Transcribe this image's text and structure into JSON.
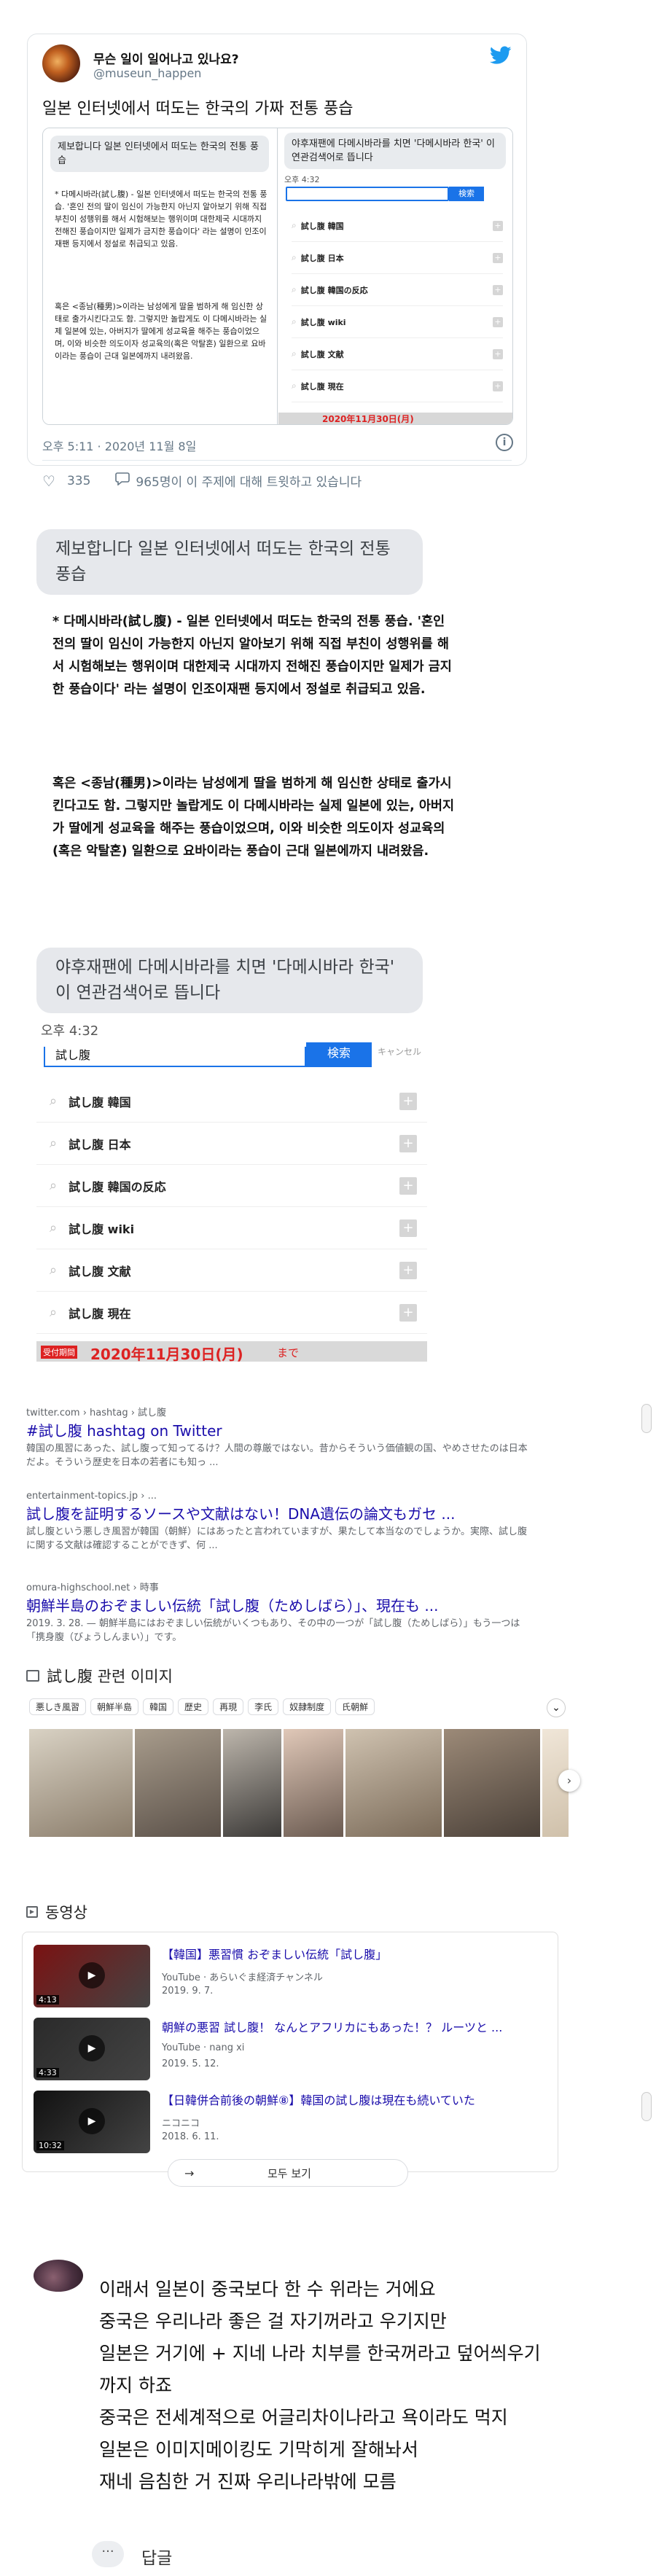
{
  "tweet": {
    "display_name": "무슨 일이 일어나고 있나요?",
    "handle": "@museun_happen",
    "text": "일본 인터넷에서 떠도는 한국의 가짜 전통 풍습",
    "media_left_bubble": "제보합니다 일본 인터넷에서 떠도는 한국의 전통 풍습",
    "media_left_p1": "* 다메시바라(試し腹) - 일본 인터넷에서 떠도는 한국의 전통 풍습. '혼인 전의 딸이 임신이 가능한지 아닌지 알아보기 위해 직접 부친이 성행위를 해서 시험해보는 행위이며 대한제국 시대까지 전해진 풍습이지만 일제가 금지한 풍습이다' 라는 설명이 인조이재팬 등지에서 정설로 취급되고 있음.",
    "media_left_p2": "혹은 <종남(種男)>이라는 남성에게 딸을 범하게 해 임신한 상태로 출가시킨다고도 함. 그렇지만 놀랍게도 이 다메시바라는 실제 일본에 있는, 아버지가 딸에게 성교육을 해주는 풍습이었으며, 이와 비슷한 의도이자 성교육의(혹은 악탈혼) 일환으로 요바이라는 풍습이 근대 일본에까지 내려왔음.",
    "media_right_bubble": "야후재팬에 다메시바라를 치면 '다메시바라 한국' 이 연관검색어로 뜹니다",
    "media_right_time": "오후 4:32",
    "media_right_search_btn": "検索",
    "media_right_items": [
      "試し腹 韓国",
      "試し腹 日本",
      "試し腹 韓国の反応",
      "試し腹 wiki",
      "試し腹 文献",
      "試し腹 現在"
    ],
    "media_right_banner": "2020年11月30日(月)",
    "timestamp": "오후 5:11 · 2020년 11월 8일",
    "likes": "335",
    "talking": "965명이 이 주제에 대해 트윗하고 있습니다",
    "info_glyph": "i"
  },
  "post": {
    "bubble1": "제보합니다 일본 인터넷에서 떠도는 한국의 전통 풍습",
    "para1": "* 다메시바라(試し腹) - 일본 인터넷에서 떠도는 한국의 전통 풍습. '혼인 전의 딸이 임신이 가능한지 아닌지 알아보기 위해 직접 부친이 성행위를 해서 시험해보는 행위이며 대한제국 시대까지 전해진 풍습이지만 일제가 금지한 풍습이다' 라는 설명이 인조이재팬 등지에서 정설로 취급되고 있음.",
    "para2": "혹은 <종남(種男)>이라는 남성에게 딸을 범하게 해 임신한 상태로 출가시킨다고도 함. 그렇지만 놀랍게도 이 다메시바라는 실제 일본에 있는, 아버지가 딸에게 성교육을 해주는 풍습이었으며, 이와 비슷한 의도이자 성교육의(혹은 악탈혼) 일환으로 요바이라는 풍습이 근대 일본에까지 내려왔음.",
    "bubble2": "야후재팬에 다메시바라를 치면 '다메시바라 한국' 이 연관검색어로 뜹니다",
    "time": "오후 4:32",
    "search_value": "試し腹",
    "search_button": "検索",
    "search_extra": "キャンセル",
    "items": [
      "試し腹 韓国",
      "試し腹 日本",
      "試し腹 韓国の反応",
      "試し腹 wiki",
      "試し腹 文献",
      "試し腹 現在"
    ],
    "banner_tag": "受付期間",
    "banner_text": "2020年11月30日(月)",
    "banner_suffix": "まで"
  },
  "google": {
    "results": [
      {
        "crumb": "twitter.com › hashtag › 試し腹",
        "title": "#試し腹 hashtag on Twitter",
        "snippet": "韓国の風習にあった、試し腹って知ってるけ？人間の尊厳ではない。昔からそういう価値観の国、やめさせたのは日本だよ。そういう歴史を日本の若者にも知っ ..."
      },
      {
        "crumb": "entertainment-topics.jp › ...",
        "title": "試し腹を証明するソースや文献はない！DNA遺伝の論文もガセ ...",
        "snippet": "試し腹という悪しき風習が韓国（朝鮮）にはあったと言われていますが、果たして本当なのでしょうか。実際、試し腹に関する文献は確認することができず、何 ..."
      },
      {
        "crumb": "omura-highschool.net › 時事",
        "title": "朝鮮半島のおぞましい伝統「試し腹（ためしばら）」、現在も ...",
        "snippet": "2019. 3. 28. — 朝鮮半島にはおぞましい伝統がいくつもあり、その中の一つが「試し腹（ためしばら）」もう一つは「携身腹（びょうしんまい）」です。"
      }
    ],
    "images_heading": "試し腹 관련 이미지",
    "chips": [
      "悪しき風習",
      "朝鮮半島",
      "韓国",
      "歴史",
      "再現",
      "李氏",
      "奴隷制度",
      "氏朝鮮"
    ],
    "videos_heading": "동영상",
    "videos": [
      {
        "title": "【韓国】悪習慣 おぞましい伝統「試し腹」",
        "channel": "YouTube · あらいぐま経済チャンネル",
        "date": "2019. 9. 7.",
        "duration": "4:13"
      },
      {
        "title": "朝鮮の悪習 試し腹！ なんとアフリカにもあった！？ ルーツと ...",
        "channel": "YouTube · nang xi",
        "date": "2019. 5. 12.",
        "duration": "4:33"
      },
      {
        "title": "【日韓併合前後の朝鮮⑧】韓国の試し腹は現在も続いていた",
        "channel": "ニコニコ",
        "date": "2018. 6. 11.",
        "duration": "10:32"
      }
    ],
    "see_all": "모두 보기"
  },
  "comment": {
    "lines": [
      "이래서 일본이 중국보다 한 수 위라는 거에요",
      "중국은 우리나라 좋은 걸 자기꺼라고 우기지만",
      "일본은 거기에 + 지네 나라 치부를 한국꺼라고 덮어씌우기",
      "까지 하죠",
      "중국은 전세계적으로 어글리차이나라고 욕이라도 먹지",
      "일본은 이미지메이킹도 기막히게 잘해놔서",
      "재네 음침한 거 진짜 우리나라밖에 모름"
    ],
    "reply": "답글",
    "more": "···"
  },
  "colors": {
    "twitter_blue": "#1d9bf0",
    "link": "#1a0dab",
    "banner_red": "#d22222"
  }
}
